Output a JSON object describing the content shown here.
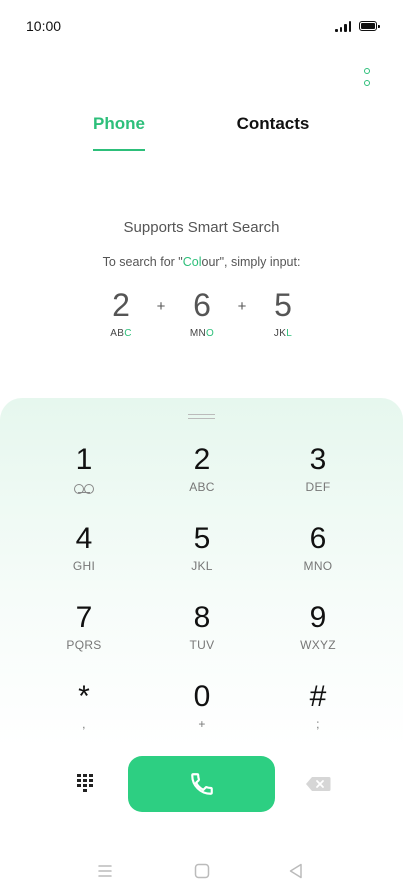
{
  "status_bar": {
    "time": "10:00"
  },
  "tabs": [
    {
      "label": "Phone",
      "active": true
    },
    {
      "label": "Contacts",
      "active": false
    }
  ],
  "smart_search": {
    "title": "Supports Smart Search",
    "hint_prefix": "To search for \"",
    "hint_highlight": "Col",
    "hint_rest": "our",
    "hint_suffix": "\", simply input:",
    "example": [
      {
        "digit": "2",
        "letters_plain": "AB",
        "letters_highlight": "C"
      },
      {
        "digit": "6",
        "letters_plain": "MN",
        "letters_highlight": "O"
      },
      {
        "digit": "5",
        "letters_plain": "JK",
        "letters_highlight": "L"
      }
    ],
    "plus": "+"
  },
  "keypad": [
    {
      "digit": "1",
      "letters": "",
      "icon": "voicemail-icon"
    },
    {
      "digit": "2",
      "letters": "ABC"
    },
    {
      "digit": "3",
      "letters": "DEF"
    },
    {
      "digit": "4",
      "letters": "GHI"
    },
    {
      "digit": "5",
      "letters": "JKL"
    },
    {
      "digit": "6",
      "letters": "MNO"
    },
    {
      "digit": "7",
      "letters": "PQRS"
    },
    {
      "digit": "8",
      "letters": "TUV"
    },
    {
      "digit": "9",
      "letters": "WXYZ"
    },
    {
      "digit": "*",
      "letters": ","
    },
    {
      "digit": "0",
      "letters": "+"
    },
    {
      "digit": "#",
      "letters": ";"
    }
  ],
  "colors": {
    "accent": "#2dbf7a",
    "call_button": "#2dcf82"
  },
  "icons": {
    "more": "more-vertical-icon",
    "call": "phone-handset-icon",
    "delete": "backspace-icon",
    "dialpad": "dialpad-icon",
    "nav": [
      "menu-icon",
      "home-square-icon",
      "back-triangle-icon"
    ]
  }
}
